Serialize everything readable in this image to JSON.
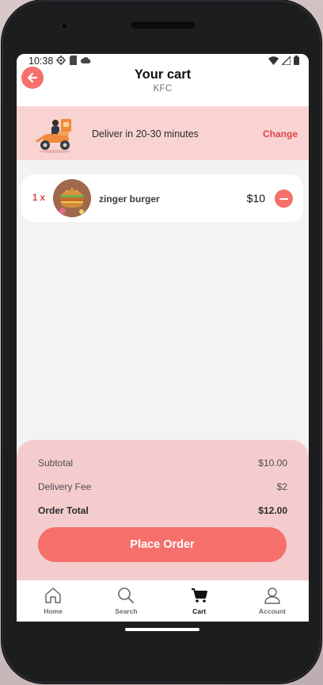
{
  "status_bar": {
    "time": "10:38",
    "left_icons": [
      "settings-icon",
      "sim-card-icon",
      "cloud-icon"
    ],
    "right_icons": [
      "wifi-icon",
      "cell-signal-icon",
      "battery-icon"
    ]
  },
  "header": {
    "title": "Your cart",
    "subtitle": "KFC",
    "back_icon": "arrow-left-icon"
  },
  "delivery": {
    "text": "Deliver in 20-30 minutes",
    "change_label": "Change",
    "illustration": "delivery-scooter-illustration"
  },
  "cart_items": [
    {
      "quantity": "1 x",
      "name": "zinger burger",
      "price": "$10",
      "remove_icon": "minus-icon"
    }
  ],
  "summary": {
    "subtotal_label": "Subtotal",
    "subtotal_value": "$10.00",
    "delivery_fee_label": "Delivery Fee",
    "delivery_fee_value": "$2",
    "order_total_label": "Order Total",
    "order_total_value": "$12.00",
    "place_order_label": "Place Order"
  },
  "bottom_nav": {
    "items": [
      {
        "label": "Home",
        "icon": "home-icon"
      },
      {
        "label": "Search",
        "icon": "search-icon"
      },
      {
        "label": "Cart",
        "icon": "cart-icon",
        "active": true
      },
      {
        "label": "Account",
        "icon": "account-icon"
      }
    ]
  },
  "colors": {
    "accent": "#f5706b",
    "accent_text": "#e0454a",
    "banner_bg": "#f9d3d2",
    "summary_bg": "#f5cccd",
    "screen_bg": "#f2f3f5"
  }
}
